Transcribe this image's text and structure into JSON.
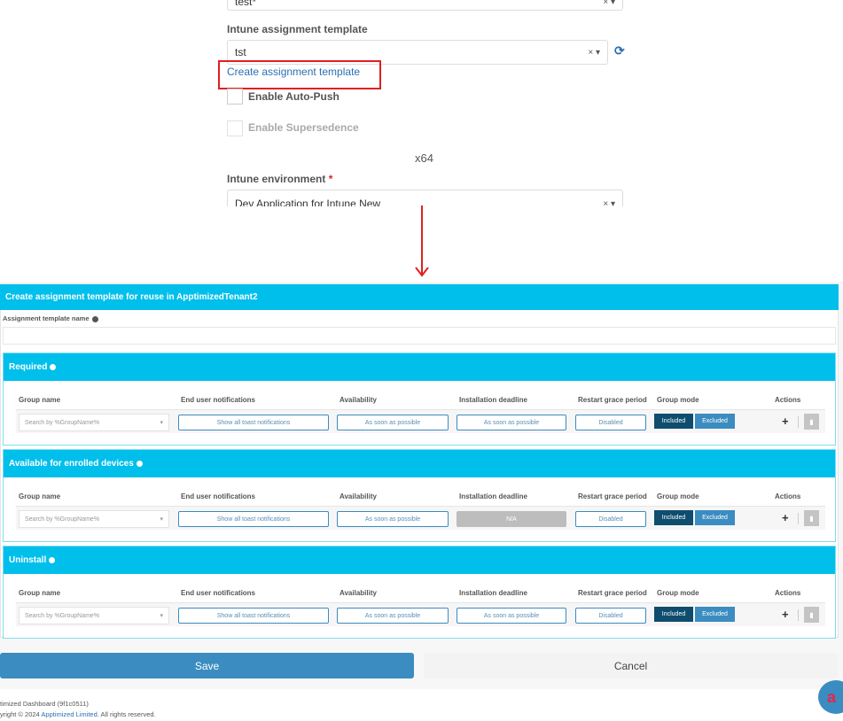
{
  "top_form": {
    "prev_field_value": "test*",
    "assignment_template_label": "Intune assignment template",
    "assignment_template_value": "tst",
    "clear_glyph": "×",
    "create_template_link": "Create assignment template",
    "auto_push_label": "Enable Auto-Push",
    "supersedence_label": "Enable Supersedence",
    "architecture": "x64",
    "environment_label": "Intune environment",
    "required_marker": "*",
    "environment_value": "Dev Application for Intune New"
  },
  "dialog": {
    "title": "Create assignment template for reuse in ApptimizedTenant2",
    "name_label": "Assignment template name",
    "name_value": "",
    "columns": [
      "Group name",
      "End user notifications",
      "Availability",
      "Installation deadline",
      "Restart grace period",
      "Group mode",
      "Actions"
    ],
    "sections": [
      {
        "title": "Required",
        "group_placeholder": "Search by %GroupName%",
        "notifications": "Show all toast notifications",
        "availability": "As soon as possible",
        "deadline": "As soon as possible",
        "deadline_disabled": false,
        "restart": "Disabled",
        "included": "Included",
        "excluded": "Excluded",
        "add": "+"
      },
      {
        "title": "Available for enrolled devices",
        "group_placeholder": "Search by %GroupName%",
        "notifications": "Show all toast notifications",
        "availability": "As soon as possible",
        "deadline": "N/A",
        "deadline_disabled": true,
        "restart": "Disabled",
        "included": "Included",
        "excluded": "Excluded",
        "add": "+"
      },
      {
        "title": "Uninstall",
        "group_placeholder": "Search by %GroupName%",
        "notifications": "Show all toast notifications",
        "availability": "As soon as possible",
        "deadline": "As soon as possible",
        "deadline_disabled": false,
        "restart": "Disabled",
        "included": "Included",
        "excluded": "Excluded",
        "add": "+"
      }
    ],
    "save_label": "Save",
    "cancel_label": "Cancel"
  },
  "footer": {
    "version": "timized Dashboard (9f1c0511)",
    "copyright_prefix": "yright © 2024 ",
    "company": "Apptimized Limited",
    "copyright_suffix": ". All rights reserved."
  },
  "colors": {
    "accent": "#00bfeb",
    "save": "#3b8cc0",
    "included": "#0e4d6e",
    "excluded": "#3b8cc0",
    "annotation": "#e02020"
  }
}
